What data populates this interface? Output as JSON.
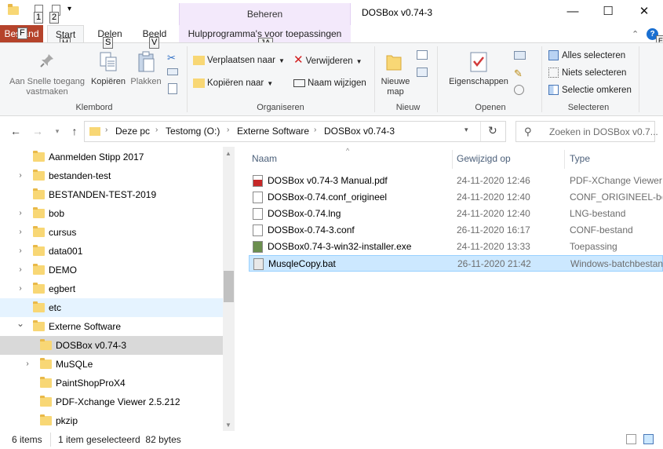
{
  "window": {
    "title": "DOSBox v0.74-3",
    "context_tab": "Beheren",
    "minimize": "—",
    "maximize": "☐",
    "close": "✕"
  },
  "keytips": {
    "qa1": "1",
    "qa2": "2",
    "file": "F",
    "start": "H",
    "share": "S",
    "view": "V",
    "tools": "JA"
  },
  "tabs": {
    "file": "Bestand",
    "start": "Start",
    "share": "Delen",
    "view": "Beeld",
    "tools": "Hulpprogramma's voor toepassingen"
  },
  "ribbon": {
    "clipboard": {
      "label": "Klembord",
      "pin": "Aan Snelle toegang vastmaken",
      "copy": "Kopiëren",
      "paste": "Plakken"
    },
    "organize": {
      "label": "Organiseren",
      "move_to": "Verplaatsen naar",
      "copy_to": "Kopiëren naar",
      "delete": "Verwijderen",
      "rename": "Naam wijzigen"
    },
    "new": {
      "label": "Nieuw",
      "new_folder": "Nieuwe map"
    },
    "open": {
      "label": "Openen",
      "properties": "Eigenschappen"
    },
    "select": {
      "label": "Selecteren",
      "select_all": "Alles selecteren",
      "select_none": "Niets selecteren",
      "invert": "Selectie omkeren"
    }
  },
  "address": {
    "crumbs": [
      "Deze pc",
      "Testomg (O:)",
      "Externe Software",
      "DOSBox v0.74-3"
    ],
    "search_placeholder": "Zoeken in DOSBox v0.7..."
  },
  "tree": {
    "items": [
      {
        "label": "Aanmelden Stipp 2017",
        "expandable": false
      },
      {
        "label": "bestanden-test",
        "expandable": true
      },
      {
        "label": "BESTANDEN-TEST-2019",
        "expandable": false
      },
      {
        "label": "bob",
        "expandable": true
      },
      {
        "label": "cursus",
        "expandable": true
      },
      {
        "label": "data001",
        "expandable": true
      },
      {
        "label": "DEMO",
        "expandable": true
      },
      {
        "label": "egbert",
        "expandable": true
      },
      {
        "label": "etc",
        "expandable": false
      },
      {
        "label": "Externe Software",
        "expandable": true
      },
      {
        "label": "DOSBox v0.74-3",
        "expandable": false
      },
      {
        "label": "MuSQLe",
        "expandable": true
      },
      {
        "label": "PaintShopProX4",
        "expandable": false
      },
      {
        "label": "PDF-Xchange Viewer 2.5.212",
        "expandable": false
      },
      {
        "label": "pkzip",
        "expandable": false
      }
    ]
  },
  "columns": {
    "name": "Naam",
    "modified": "Gewijzigd op",
    "type": "Type"
  },
  "files": [
    {
      "name": "DOSBox v0.74-3 Manual.pdf",
      "modified": "24-11-2020 12:46",
      "type": "PDF-XChange Viewer Document"
    },
    {
      "name": "DOSBox-0.74.conf_origineel",
      "modified": "24-11-2020 12:40",
      "type": "CONF_ORIGINEEL-bestand"
    },
    {
      "name": "DOSBox-0.74.lng",
      "modified": "24-11-2020 12:40",
      "type": "LNG-bestand"
    },
    {
      "name": "DOSBox-0.74-3.conf",
      "modified": "26-11-2020 16:17",
      "type": "CONF-bestand"
    },
    {
      "name": "DOSBox0.74-3-win32-installer.exe",
      "modified": "24-11-2020 13:33",
      "type": "Toepassing"
    },
    {
      "name": "MusqleCopy.bat",
      "modified": "26-11-2020 21:42",
      "type": "Windows-batchbestand"
    }
  ],
  "status": {
    "items": "6 items",
    "selected": "1 item geselecteerd  82 bytes"
  },
  "colors": {
    "accent": "#cce8ff",
    "file_tab": "#b5432b",
    "context_tab": "#f3e9fb"
  }
}
